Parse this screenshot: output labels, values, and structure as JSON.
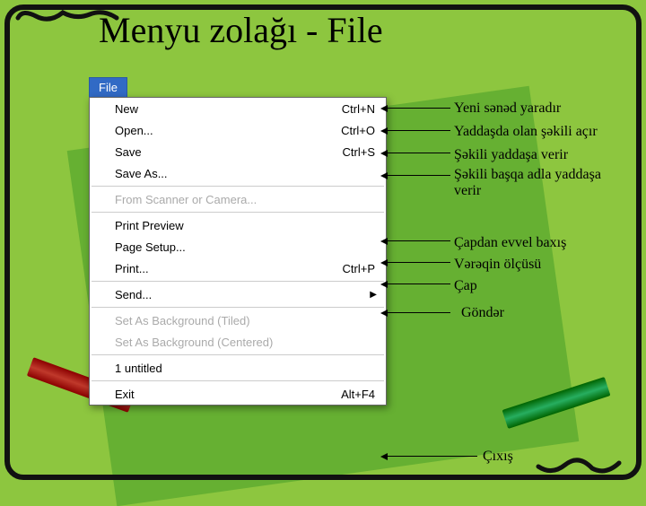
{
  "title": "Menyu zolağı - File",
  "file_tab": "File",
  "menu": {
    "new": {
      "label": "New",
      "shortcut": "Ctrl+N"
    },
    "open": {
      "label": "Open...",
      "shortcut": "Ctrl+O"
    },
    "save": {
      "label": "Save",
      "shortcut": "Ctrl+S"
    },
    "saveas": {
      "label": "Save As...",
      "shortcut": ""
    },
    "scanner": {
      "label": "From Scanner or Camera...",
      "shortcut": ""
    },
    "preview": {
      "label": "Print Preview",
      "shortcut": ""
    },
    "pagesetup": {
      "label": "Page Setup...",
      "shortcut": ""
    },
    "print": {
      "label": "Print...",
      "shortcut": "Ctrl+P"
    },
    "send": {
      "label": "Send...",
      "shortcut": ""
    },
    "bg_tiled": {
      "label": "Set As Background (Tiled)",
      "shortcut": ""
    },
    "bg_center": {
      "label": "Set As Background (Centered)",
      "shortcut": ""
    },
    "recent1": {
      "label": "1 untitled",
      "shortcut": ""
    },
    "exit": {
      "label": "Exit",
      "shortcut": "Alt+F4"
    }
  },
  "annotations": {
    "new": "Yeni sənəd yaradır",
    "open": "Yaddaşda olan şəkili açır",
    "save": "Şəkili yaddaşa verir",
    "saveas": "Şəkili başqa adla yaddaşa verir",
    "preview": "Çapdan evvel baxış",
    "pagesetup": "Vərəqin ölçüsü",
    "print": "Çap",
    "send": "Göndər",
    "exit": "Çıxış"
  }
}
